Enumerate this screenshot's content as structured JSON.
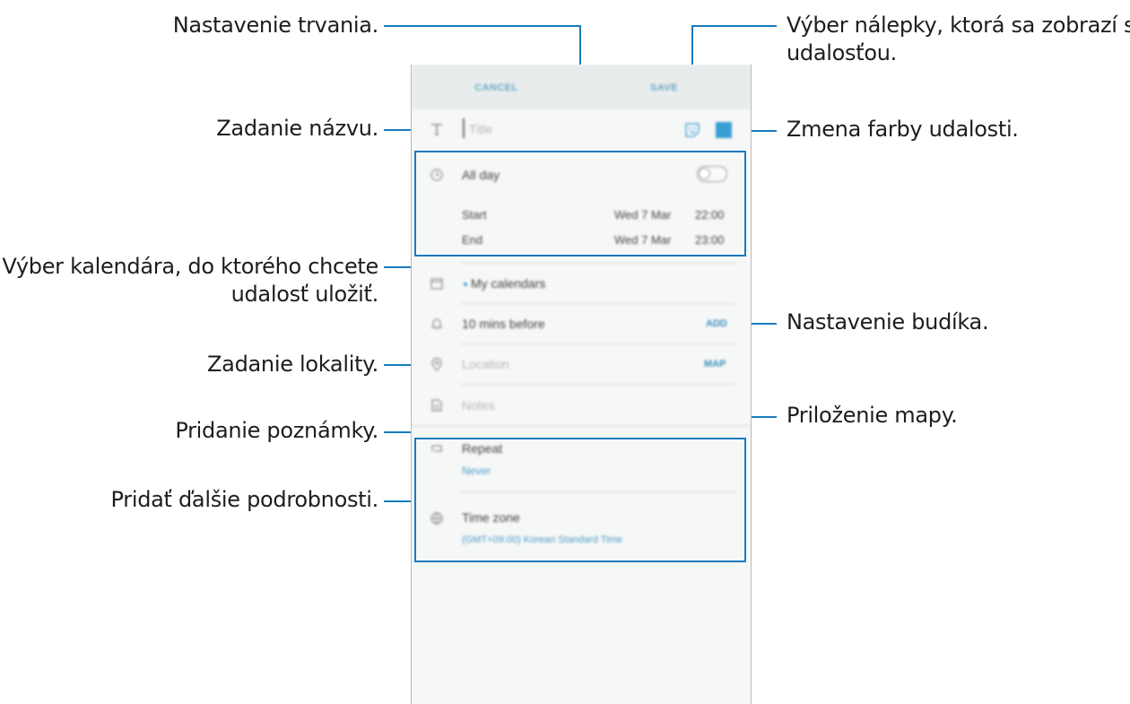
{
  "callouts": {
    "duration": "Nastavenie trvania.",
    "title_entry": "Zadanie názvu.",
    "calendar_line1": "Výber kalendára, do ktorého chcete",
    "calendar_line2": "udalosť uložiť.",
    "location": "Zadanie lokality.",
    "note": "Pridanie poznámky.",
    "more_details": "Pridať ďalšie podrobnosti.",
    "sticker_line1": "Výber nálepky, ktorá sa zobrazí s",
    "sticker_line2": "udalosťou.",
    "color": "Zmena farby udalosti.",
    "alarm": "Nastavenie budíka.",
    "map": "Priloženie mapy."
  },
  "screen": {
    "cancel_label": "CANCEL",
    "save_label": "SAVE",
    "title_placeholder": "Title",
    "all_day_label": "All day",
    "all_day_on": false,
    "start_label": "Start",
    "start_date": "Wed 7 Mar",
    "start_time": "22:00",
    "end_label": "End",
    "end_date": "Wed 7 Mar",
    "end_time": "23:00",
    "calendar_value": "My calendars",
    "reminder_value": "10 mins before",
    "reminder_add": "ADD",
    "location_placeholder": "Location",
    "map_label": "MAP",
    "notes_placeholder": "Notes",
    "repeat_label": "Repeat",
    "repeat_value": "Never",
    "timezone_label": "Time zone",
    "timezone_value": "(GMT+09:00) Korean Standard Time"
  },
  "colors": {
    "accent": "#1a7bbf",
    "event_color": "#3a9fd4"
  },
  "icons": [
    "title-icon",
    "clock-icon",
    "calendar-icon",
    "bell-icon",
    "location-pin-icon",
    "note-icon",
    "repeat-icon",
    "globe-icon",
    "sticker-icon"
  ]
}
